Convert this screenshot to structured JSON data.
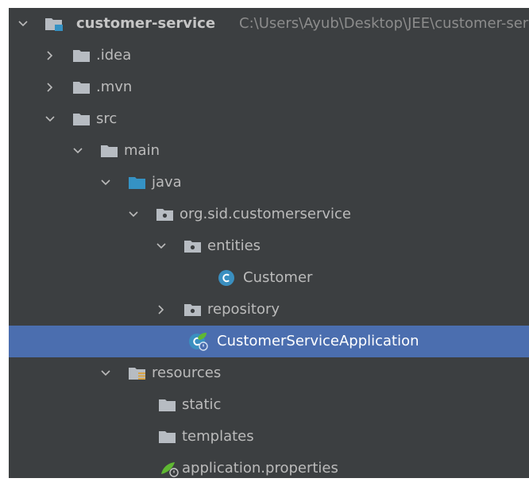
{
  "tree": {
    "root": {
      "label": "customer-service",
      "path": "C:\\Users\\Ayub\\Desktop\\JEE\\customer-service"
    },
    "items": [
      {
        "label": ".idea"
      },
      {
        "label": ".mvn"
      },
      {
        "label": "src"
      },
      {
        "label": "main"
      },
      {
        "label": "java"
      },
      {
        "label": "org.sid.customerservice"
      },
      {
        "label": "entities"
      },
      {
        "label": "Customer"
      },
      {
        "label": "repository"
      },
      {
        "label": "CustomerServiceApplication"
      },
      {
        "label": "resources"
      },
      {
        "label": "static"
      },
      {
        "label": "templates"
      },
      {
        "label": "application.properties"
      }
    ]
  },
  "colors": {
    "background": "#3c3f41",
    "selection": "#4b6eaf",
    "text": "#bbbbbb",
    "folder": "#b7bcc2",
    "source_folder": "#3592c4",
    "class_icon": "#3a8fc0",
    "spring_leaf": "#5fb832"
  },
  "icons": {
    "expanded": "chevron-down-icon",
    "collapsed": "chevron-right-icon",
    "module": "module-folder-icon",
    "folder": "folder-icon",
    "source_folder": "source-folder-icon",
    "package": "package-icon",
    "resources": "resources-folder-icon",
    "class": "class-icon",
    "spring_boot_app": "spring-boot-application-icon",
    "properties": "spring-properties-icon"
  }
}
